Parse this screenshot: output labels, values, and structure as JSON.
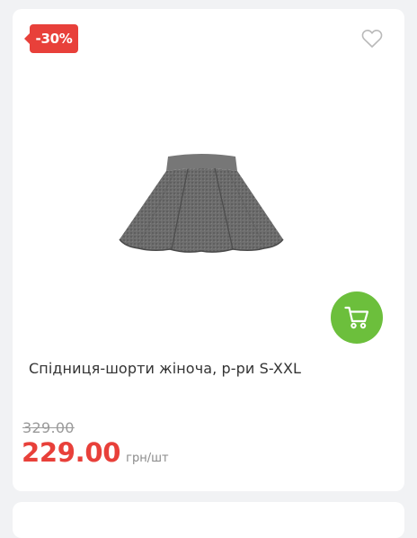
{
  "product": {
    "discount_badge": "-30%",
    "title": "Спідниця-шорти жіноча, р-ри S-XXL",
    "old_price": "329.00",
    "price": "229.00",
    "price_unit": "грн/шт",
    "image_alt": "grey flared skirt"
  },
  "icons": {
    "favorite": "heart-outline-icon",
    "cart": "shopping-cart-icon"
  },
  "colors": {
    "badge": "#e8403a",
    "price": "#e8403a",
    "cart_button": "#6cbf3c",
    "old_price": "#9a9a9a",
    "background": "#f1f2f4"
  }
}
